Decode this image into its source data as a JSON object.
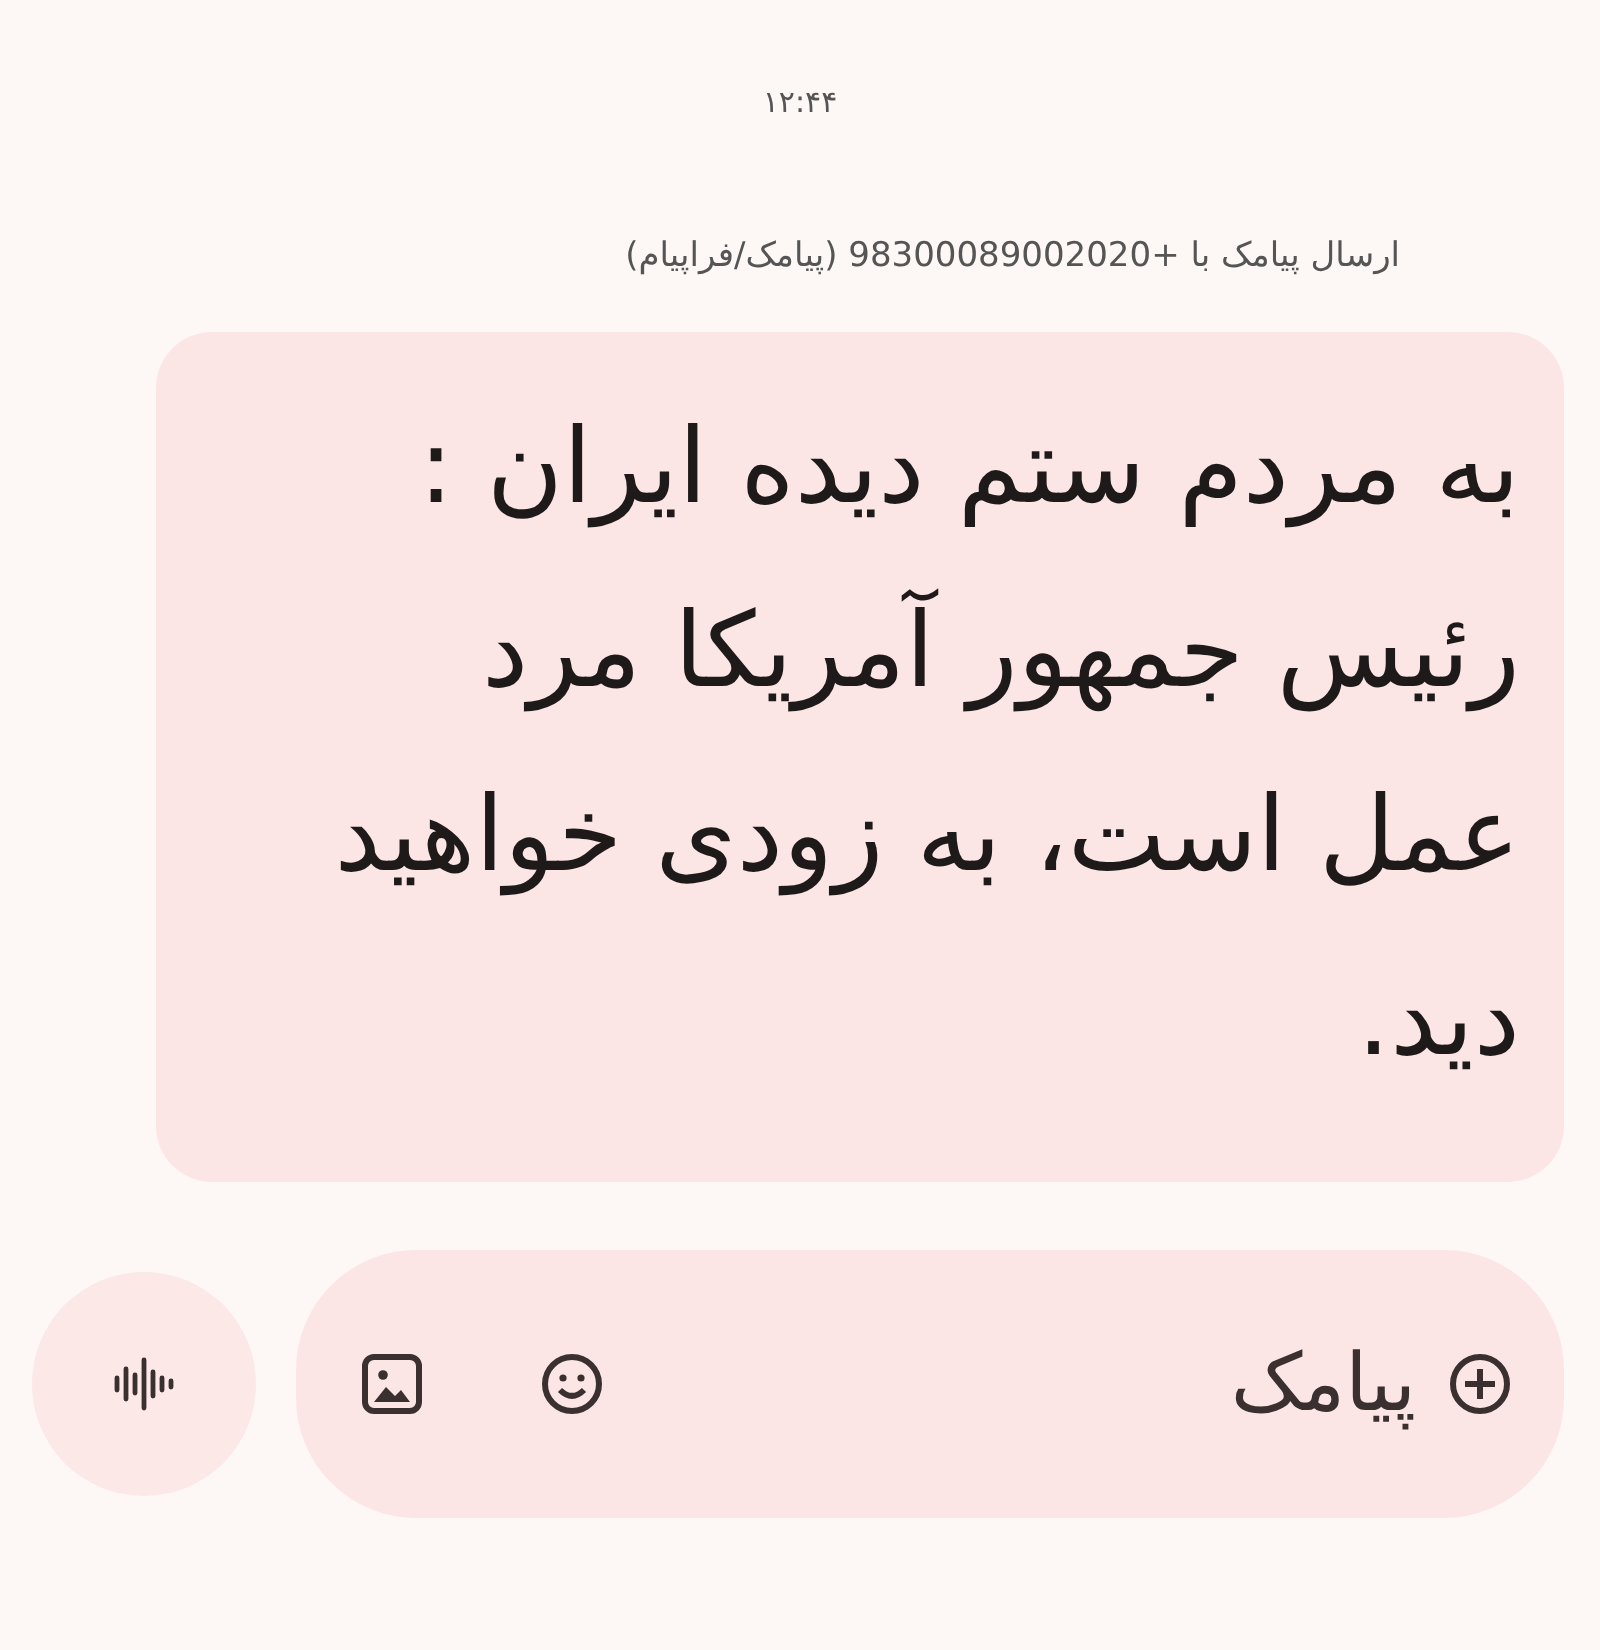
{
  "timestamp": "۱۲:۴۴",
  "sender_info": "ارسال پیامک با +98300089002020 (پیامک/فراپیام)",
  "message": {
    "text": "به مردم ستم دیده ایران : رئیس جمهور آمریکا مرد عمل است، به زودی خواهید دید."
  },
  "composer": {
    "placeholder": "پیامک"
  }
}
